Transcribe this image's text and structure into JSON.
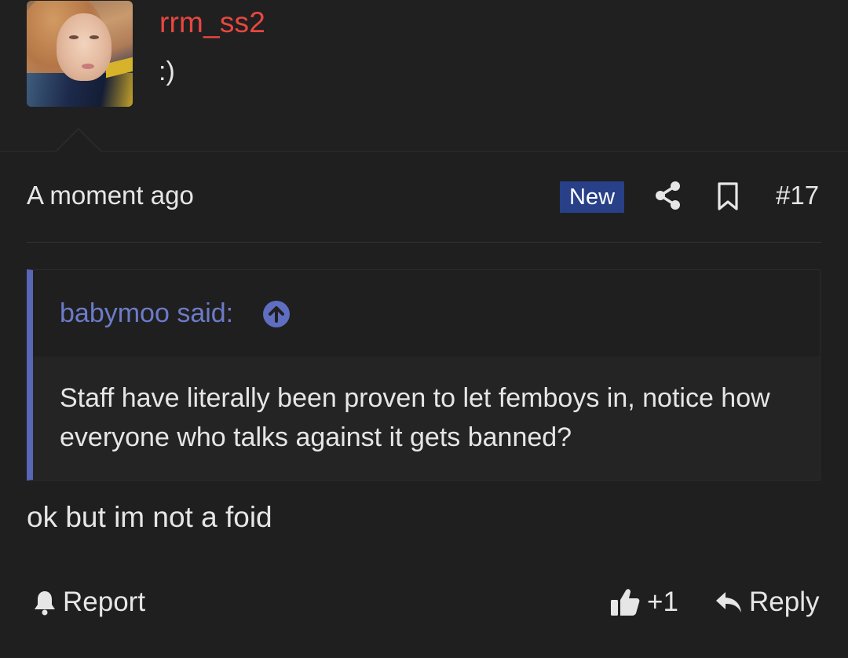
{
  "user": {
    "username": "rrm_ss2",
    "title": ":)"
  },
  "post_meta": {
    "time": "A moment ago",
    "badge": "New",
    "post_number": "#17"
  },
  "quote": {
    "author": "babymoo said:",
    "text": "Staff have literally been proven to let femboys in, notice how everyone who talks against it gets banned?"
  },
  "message": {
    "text": "ok but im not a foid"
  },
  "actions": {
    "report_label": "Report",
    "like_count": "+1",
    "reply_label": "Reply"
  },
  "icons": {
    "share": "share-icon",
    "bookmark": "bookmark-icon",
    "quote_jump": "arrow-up-circle-icon",
    "report": "bell-icon",
    "like": "thumbs-up-icon",
    "reply": "reply-arrow-icon"
  },
  "colors": {
    "background": "#1f1f20",
    "username": "#e8473f",
    "badge": "#274088",
    "quote_accent": "#5866b5",
    "quote_author": "#6d7bc8"
  }
}
